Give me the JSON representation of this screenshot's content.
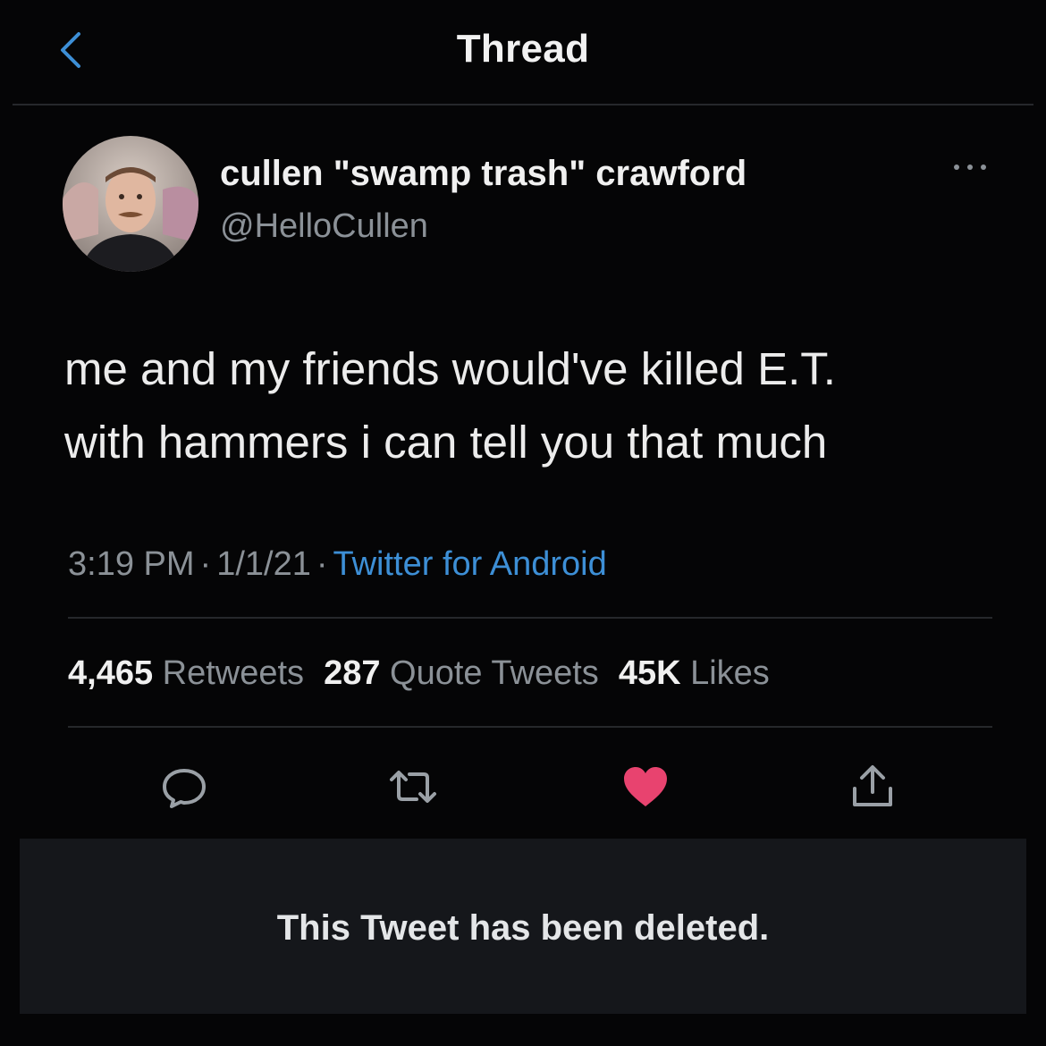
{
  "header": {
    "title": "Thread"
  },
  "tweet": {
    "author_name": "cullen \"swamp trash\" crawford",
    "author_handle": "@HelloCullen",
    "text_line_1": "me and my friends would've killed E.T.",
    "text_line_2": "with hammers i can tell you that much",
    "time": "3:19 PM",
    "date": "1/1/21",
    "separator": "·",
    "source": "Twitter for Android",
    "stats": {
      "retweets_count": "4,465",
      "retweets_label": "Retweets",
      "quotes_count": "287",
      "quotes_label": "Quote Tweets",
      "likes_count": "45K",
      "likes_label": "Likes"
    },
    "liked": true
  },
  "actions": {
    "icons": [
      "reply-icon",
      "retweet-icon",
      "like-icon",
      "share-icon"
    ]
  },
  "deleted_notice": {
    "text": "This Tweet has been deleted."
  },
  "colors": {
    "background": "#050506",
    "accent_link": "#3d8fd6",
    "like_active": "#e8436f",
    "muted_text": "#8b9197",
    "icon_color": "#9aa0a6"
  }
}
